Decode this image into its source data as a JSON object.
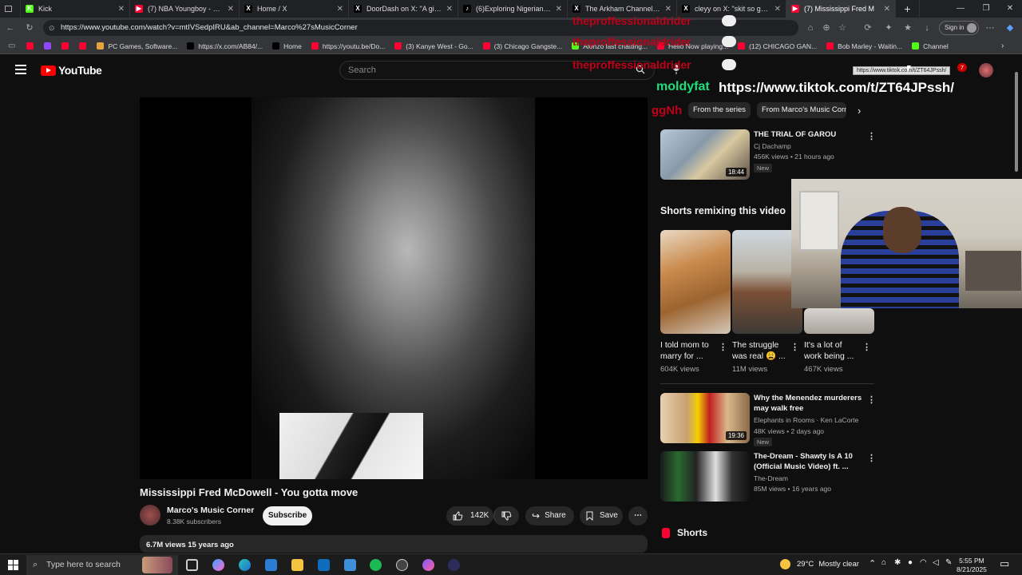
{
  "browser": {
    "tabs": [
      {
        "label": "Kick",
        "color": "#53fc18",
        "glyph": "K"
      },
      {
        "label": "(7) NBA Youngboy - F*ck Th",
        "color": "#ff0033",
        "glyph": "▶"
      },
      {
        "label": "Home / X",
        "color": "#000000",
        "glyph": "X"
      },
      {
        "label": "DoorDash on X: \"A gift fro",
        "color": "#000000",
        "glyph": "X"
      },
      {
        "label": "(6)Exploring Nigerian Cultu",
        "color": "#000000",
        "glyph": "♪"
      },
      {
        "label": "The Arkham Channel on X",
        "color": "#000000",
        "glyph": "X"
      },
      {
        "label": "cleyy on X: \"skit so good it",
        "color": "#000000",
        "glyph": "X"
      },
      {
        "label": "(7) Mississippi Fred M",
        "color": "#ff0033",
        "glyph": "▶"
      }
    ],
    "url": "https://www.youtube.com/watch?v=mtIVSedpIRU&ab_channel=Marco%27sMusicCorner",
    "signin_label": "Sign in",
    "bookmarks": [
      {
        "label": "",
        "color": "#ff0033"
      },
      {
        "label": "",
        "color": "#9146ff"
      },
      {
        "label": "",
        "color": "#ff0033"
      },
      {
        "label": "",
        "color": "#ff0033"
      },
      {
        "label": "PC Games, Software...",
        "color": "#e8a33d"
      },
      {
        "label": "https://x.com/AB84/...",
        "color": "#000000"
      },
      {
        "label": "Home",
        "color": "#000000"
      },
      {
        "label": "https://youtu.be/Do...",
        "color": "#ff0033"
      },
      {
        "label": "(3) Kanye West - Go...",
        "color": "#ff0033"
      },
      {
        "label": "(3) Chicago Gangste...",
        "color": "#ff0033"
      },
      {
        "label": "Alonzo last chatting...",
        "color": "#53fc18"
      },
      {
        "label": "Hello Now playing...",
        "color": "#ff0033"
      },
      {
        "label": "(12) CHICAGO GAN...",
        "color": "#ff0033"
      },
      {
        "label": "Bob Marley - Waitin...",
        "color": "#ff0033"
      },
      {
        "label": "Channel",
        "color": "#53fc18"
      }
    ]
  },
  "youtube": {
    "logo_text": "YouTube",
    "search_placeholder": "Search",
    "video": {
      "title": "Mississippi Fred McDowell - You gotta move",
      "channel": "Marco's Music Corner",
      "subscribers": "8.38K subscribers",
      "subscribe_label": "Subscribe",
      "likes": "142K",
      "share_label": "Share",
      "save_label": "Save",
      "views_line": "6.7M views  15 years ago"
    },
    "chips": [
      "From the series",
      "From Marco's Music Corner"
    ],
    "recommended_top": {
      "title": "THE TRIAL OF GAROU",
      "channel": "Cj Dachamp",
      "meta": "456K views • 21 hours ago",
      "badge": "New",
      "duration": "18:44"
    },
    "shorts_heading": "Shorts remixing this video",
    "shorts": [
      {
        "title": "I told mom to marry for ...",
        "views": "604K views"
      },
      {
        "title": "The struggle was real 😩 ...",
        "views": "11M views"
      },
      {
        "title": "It's a lot of work being ...",
        "views": "467K views"
      }
    ],
    "recommended": [
      {
        "title": "Why the Menendez murderers may walk free",
        "channel": "Elephants in Rooms · Ken LaCorte",
        "meta": "48K views • 2 days ago",
        "badge": "New",
        "duration": "19:36"
      },
      {
        "title": "The-Dream - Shawty Is A 10 (Official Music Video) ft. ...",
        "channel": "The-Dream",
        "meta": "85M views • 16 years ago",
        "badge": "",
        "duration": ""
      }
    ],
    "shorts_footer": "Shorts",
    "notification_count": "7"
  },
  "overlay": {
    "chat_name_1": "theproffessionaldrider",
    "chat_name_2": "theproffessionaldrider",
    "chat_name_3": "theproffessionaldrider",
    "chat_user": "moldyfat",
    "chat_link": "https://www.tiktok.com/t/ZT64JPssh/",
    "chat_user_2": "ggNh",
    "tooltip": "https://www.tiktok.com/t/ZT64JPssh/"
  },
  "taskbar": {
    "search_placeholder": "Type here to search",
    "temperature": "29°C",
    "weather": "Mostly clear",
    "time": "5:55 PM",
    "date": "8/21/2025"
  }
}
